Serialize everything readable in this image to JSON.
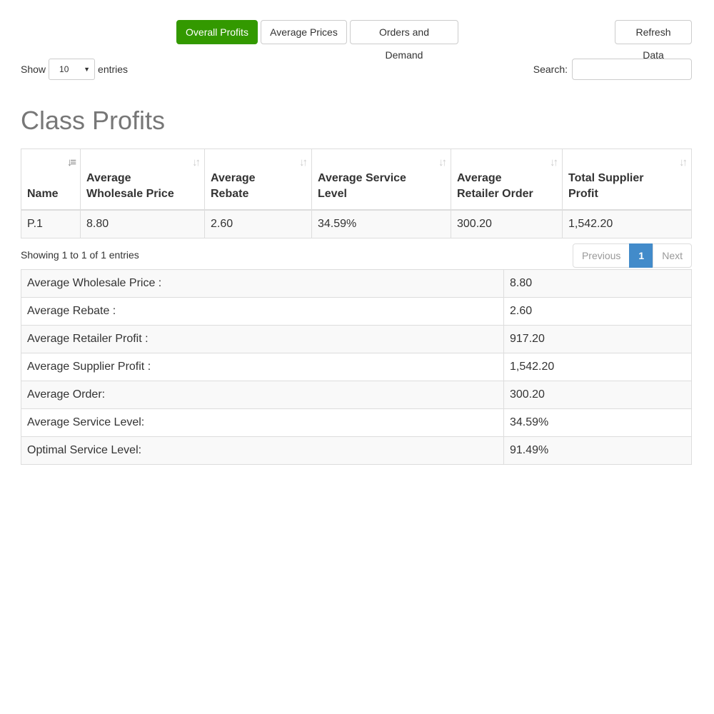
{
  "colors": {
    "accent": "#339900",
    "pager_active": "#428bca"
  },
  "toolbar": {
    "tabs": [
      {
        "label": "Overall Profits",
        "active": true
      },
      {
        "label": "Average Prices",
        "active": false
      },
      {
        "label": "Orders and Demand",
        "active": false
      }
    ],
    "refresh_label": "Refresh Data"
  },
  "length_control": {
    "prefix": "Show",
    "value": "10",
    "suffix": "entries"
  },
  "search": {
    "label": "Search:",
    "value": "",
    "placeholder": ""
  },
  "title": "Class Profits",
  "table": {
    "columns": [
      {
        "label": "Name",
        "sort_icon": "sort-amount-asc-icon"
      },
      {
        "label": "Average Wholesale Price",
        "sort_icon": "sort-icon"
      },
      {
        "label": "Average Rebate",
        "sort_icon": "sort-icon"
      },
      {
        "label": "Average Service Level",
        "sort_icon": "sort-icon"
      },
      {
        "label": "Average Retailer Order",
        "sort_icon": "sort-icon"
      },
      {
        "label": "Total Supplier Profit",
        "sort_icon": "sort-icon"
      }
    ],
    "rows": [
      [
        "P.1",
        "8.80",
        "2.60",
        "34.59%",
        "300.20",
        "1,542.20"
      ]
    ]
  },
  "info": "Showing 1 to 1 of 1 entries",
  "pagination": {
    "previous": "Previous",
    "current": "1",
    "next": "Next"
  },
  "summary": [
    {
      "label": "Average Wholesale Price :",
      "value": "8.80"
    },
    {
      "label": "Average Rebate :",
      "value": "2.60"
    },
    {
      "label": "Average Retailer Profit :",
      "value": "917.20"
    },
    {
      "label": "Average Supplier Profit :",
      "value": "1,542.20"
    },
    {
      "label": "Average Order:",
      "value": "300.20"
    },
    {
      "label": "Average Service Level:",
      "value": "34.59%"
    },
    {
      "label": "Optimal Service Level:",
      "value": "91.49%"
    }
  ]
}
